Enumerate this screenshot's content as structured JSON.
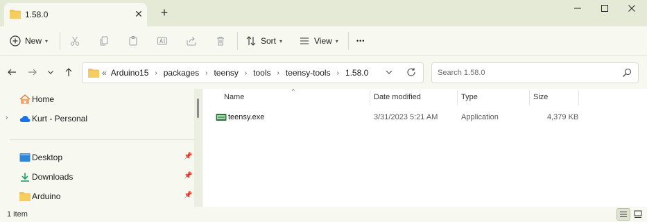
{
  "tab": {
    "title": "1.58.0",
    "close_glyph": "✕",
    "new_tab_glyph": "+"
  },
  "window_controls": {
    "minimize": "—",
    "maximize": "☐",
    "close": "✕"
  },
  "toolbar": {
    "new_label": "New",
    "sort_label": "Sort",
    "view_label": "View",
    "more_glyph": "•••"
  },
  "address": {
    "overflow_glyph": "«",
    "crumbs": [
      "Arduino15",
      "packages",
      "teensy",
      "tools",
      "teensy-tools",
      "1.58.0"
    ]
  },
  "search": {
    "placeholder": "Search 1.58.0"
  },
  "nav": {
    "items": [
      {
        "label": "Home",
        "icon": "home-icon"
      },
      {
        "label": "Kurt - Personal",
        "icon": "cloud-icon"
      },
      {
        "label": "Desktop",
        "icon": "desktop-icon"
      },
      {
        "label": "Downloads",
        "icon": "download-icon"
      },
      {
        "label": "Arduino",
        "icon": "folder-icon"
      }
    ]
  },
  "columns": {
    "name": "Name",
    "date": "Date modified",
    "type": "Type",
    "size": "Size"
  },
  "files": [
    {
      "name": "teensy.exe",
      "date": "3/31/2023 5:21 AM",
      "type": "Application",
      "size": "4,379 KB",
      "icon": "exe-icon"
    }
  ],
  "status": {
    "item_count": "1 item"
  },
  "colors": {
    "accent_folder": "#f2c14e",
    "background": "#f7f9f1",
    "tabbar": "#e4ead6"
  }
}
